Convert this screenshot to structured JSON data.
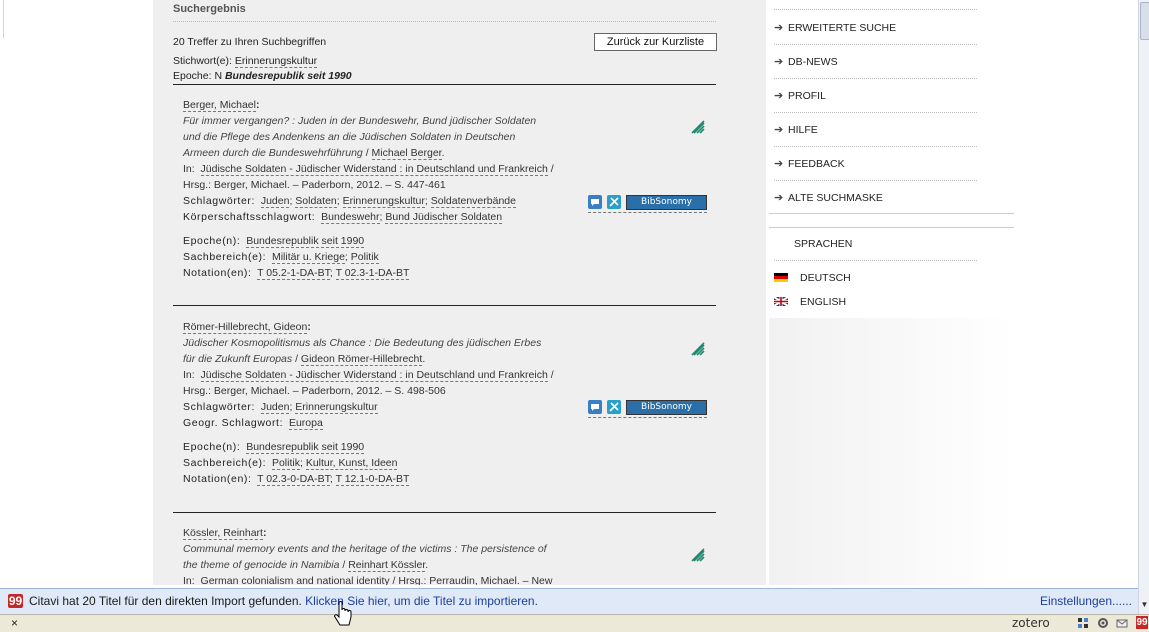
{
  "result": {
    "heading": "Suchergebnis",
    "count_text": "20 Treffer zu Ihren Suchbegriffen",
    "back_button": "Zurück zur Kurzliste",
    "stichwort_label": "Stichwort(e):",
    "stichwort_value": "Erinnerungskultur",
    "epoche_label": "Epoche:",
    "epoche_prefix": "N",
    "epoche_value": "Bundesrepublik seit 1990"
  },
  "hits": [
    {
      "author": "Berger, Michael",
      "title_1": "Für immer vergangen? : Juden in der Bundeswehr, Bund jüdischer Soldaten",
      "title_2": "und die Pflege des Andenkens an die Jüdischen Soldaten in Deutschen",
      "title_3": "Armeen durch die Bundeswehrführung",
      "title_resp": "Michael Berger",
      "in_label": "In:",
      "in_link": "Jüdische Soldaten - Jüdischer Widerstand : in Deutschland und Frankreich",
      "in_rest": "Hrsg.: Berger, Michael. – Paderborn, 2012. – S. 447-461",
      "sw_label": "Schlagwörter:",
      "sw": [
        "Juden",
        "Soldaten",
        "Erinnerungskultur",
        "Soldatenverbände"
      ],
      "extra_label": "Körperschaftsschlagwort:",
      "extra": [
        "Bundeswehr",
        "Bund Jüdischer Soldaten"
      ],
      "epoche_label": "Epoche(n):",
      "epoche": [
        "Bundesrepublik seit 1990"
      ],
      "sach_label": "Sachbereich(e):",
      "sach": [
        "Militär u. Kriege",
        "Politik"
      ],
      "not_label": "Notation(en):",
      "notation": [
        "T 05.2-1-DA-BT",
        "T 02.3-1-DA-BT"
      ]
    },
    {
      "author": "Römer-Hillebrecht, Gideon",
      "title_1": "Jüdischer Kosmopolitismus als Chance : Die Bedeutung des jüdischen Erbes",
      "title_2": "für die Zukunft Europas",
      "title_resp": "Gideon Römer-Hillebrecht",
      "in_label": "In:",
      "in_link": "Jüdische Soldaten - Jüdischer Widerstand : in Deutschland und Frankreich",
      "in_rest": "Hrsg.: Berger, Michael. – Paderborn, 2012. – S. 498-506",
      "sw_label": "Schlagwörter:",
      "sw": [
        "Juden",
        "Erinnerungskultur"
      ],
      "extra_label": "Geogr. Schlagwort:",
      "extra": [
        "Europa"
      ],
      "epoche_label": "Epoche(n):",
      "epoche": [
        "Bundesrepublik seit 1990"
      ],
      "sach_label": "Sachbereich(e):",
      "sach": [
        "Politik",
        "Kultur, Kunst, Ideen"
      ],
      "not_label": "Notation(en):",
      "notation": [
        "T 02.3-0-DA-BT",
        "T 12.1-0-DA-BT"
      ]
    },
    {
      "author": "Kössler, Reinhart",
      "title_1": "Communal memory events and the heritage of the victims : The persistence of",
      "title_2": "the theme of genocide in Namibia",
      "title_resp": "Reinhart Kössler",
      "in_label": "In:",
      "in_text": "German colonialism and national identity / Hrsg.: Perraudin, Michael. – New"
    }
  ],
  "bibsonomy_label": "BibSonomy",
  "sidebar": {
    "nav": [
      "ERWEITERTE SUCHE",
      "DB-NEWS",
      "PROFIL",
      "HILFE",
      "FEEDBACK",
      "ALTE SUCHMASKE"
    ],
    "languages_heading": "SPRACHEN",
    "languages": [
      "DEUTSCH",
      "ENGLISH"
    ]
  },
  "citavi": {
    "logo": "99",
    "message": "Citavi hat 20 Titel für den direkten Import gefunden.",
    "link": "Klicken Sie hier, um die Titel zu importieren.",
    "settings": "Einstellungen......"
  },
  "statusbar": {
    "close": "×",
    "zotero": "zotero"
  },
  "colors": {
    "content_bg": "#efefef",
    "citavi_bar_bg": "#dfe9f7",
    "link_blue": "#1d3f9a",
    "bibsonomy_bg": "#2a6fa8",
    "status_bg": "#ece9d8"
  }
}
